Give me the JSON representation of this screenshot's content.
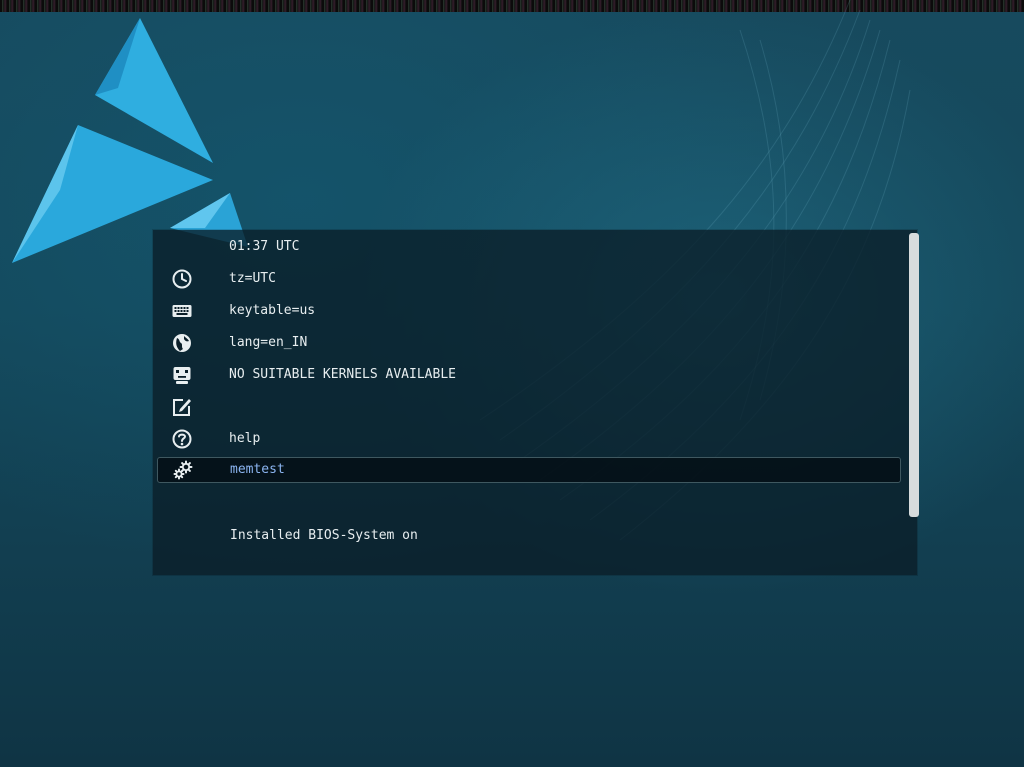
{
  "boot_menu": {
    "clock": "01:37 UTC",
    "items": [
      {
        "icon": "clock-icon",
        "label": "tz=UTC"
      },
      {
        "icon": "keyboard-icon",
        "label": "keytable=us"
      },
      {
        "icon": "globe-icon",
        "label": "lang=en_IN"
      },
      {
        "icon": "monitor-icon",
        "label": "NO SUITABLE KERNELS AVAILABLE"
      },
      {
        "icon": "edit-icon",
        "label": ""
      },
      {
        "icon": "help-icon",
        "label": "help"
      },
      {
        "icon": "gears-icon",
        "label": "memtest",
        "selected": true
      }
    ],
    "status": "Installed BIOS-System on"
  },
  "colors": {
    "background": "#14485b",
    "panel": "#0a1e28",
    "text": "#e8eef0",
    "selected_text": "#8bb4f0",
    "logo": "#29a9dc"
  }
}
